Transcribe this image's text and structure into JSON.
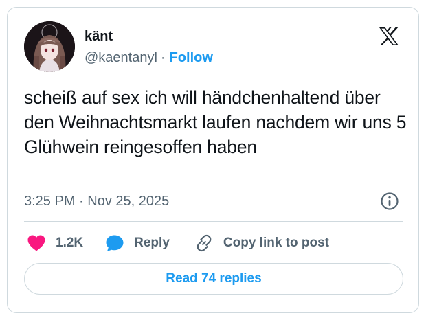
{
  "author": {
    "display_name": "känt",
    "handle": "@kaentanyl",
    "separator": "·",
    "follow_label": "Follow"
  },
  "logo_icon": "x-logo-icon",
  "tweet": {
    "text": "scheiß auf sex ich will händchenhaltend über den Weihnachtsmarkt laufen nachdem wir uns 5 Glühwein reingesoffen haben",
    "time": "3:25 PM",
    "date": "Nov 25, 2025",
    "timestamp_separator": "·"
  },
  "actions": {
    "like_count": "1.2K",
    "reply_label": "Reply",
    "copy_link_label": "Copy link to post"
  },
  "read_replies_label": "Read 74 replies",
  "colors": {
    "accent": "#1d9bf0",
    "like": "#f91880",
    "text": "#0f1419",
    "muted": "#536471",
    "border": "#cfd9de"
  }
}
